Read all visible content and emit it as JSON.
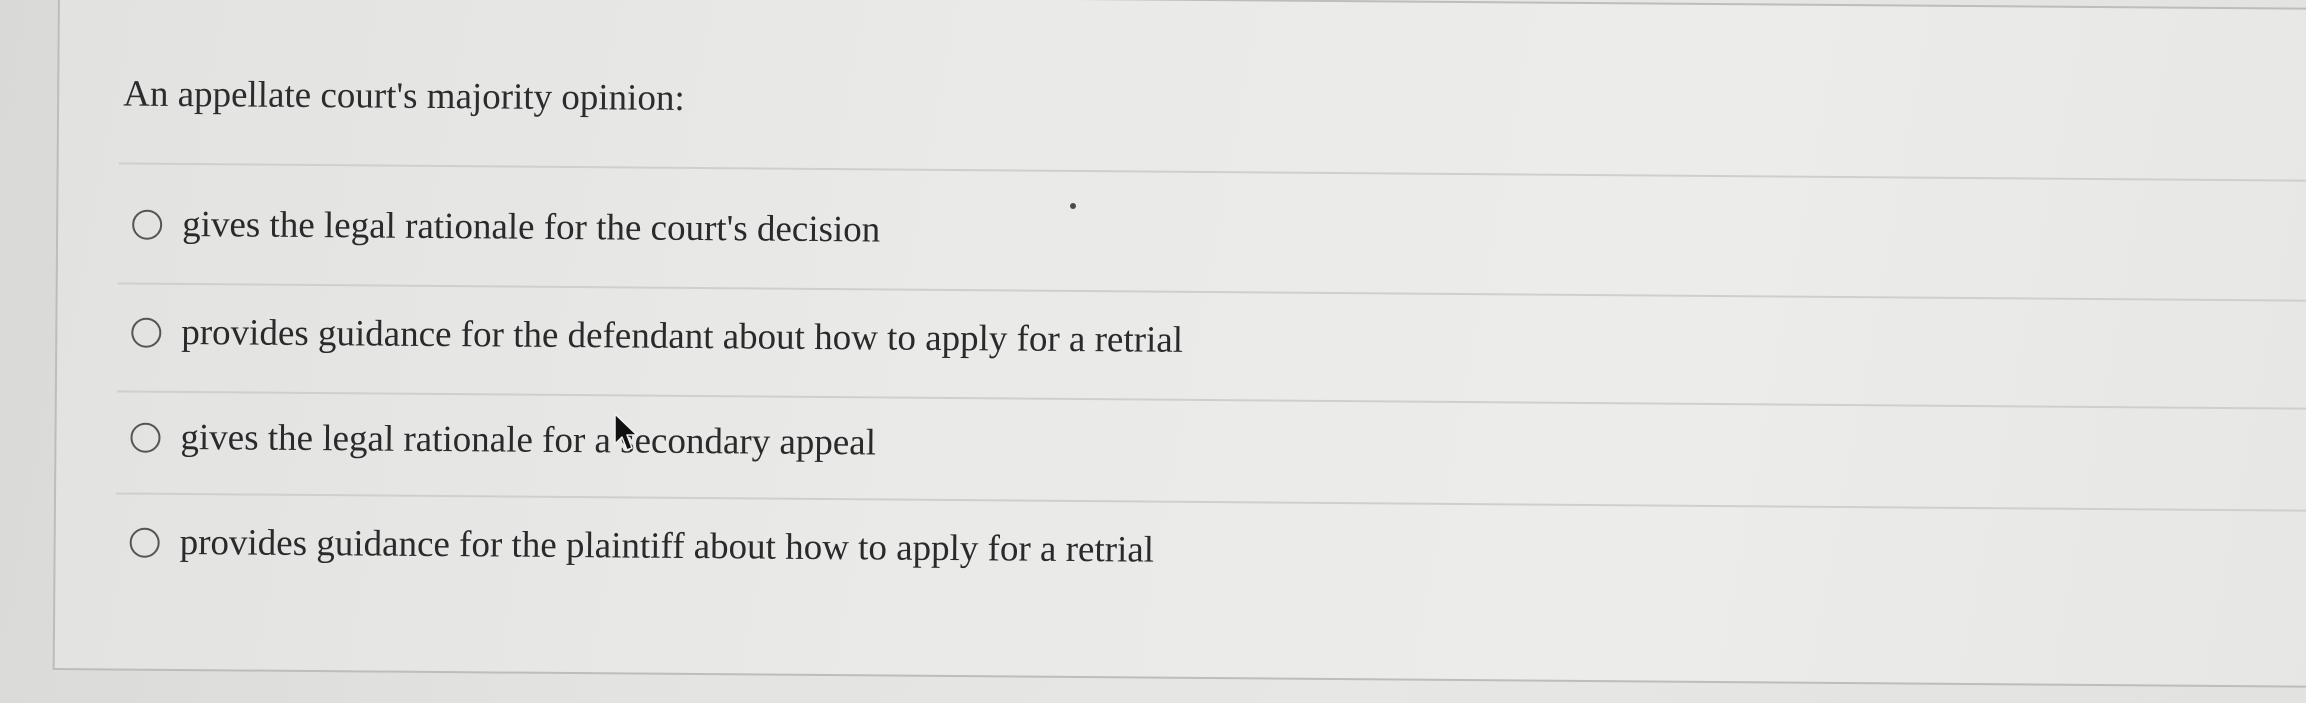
{
  "question": {
    "prompt": "An appellate court's majority opinion:"
  },
  "options": [
    {
      "label": "gives the legal rationale for the court's decision",
      "selected": false
    },
    {
      "label": "provides guidance for the defendant about how to apply for a retrial",
      "selected": false
    },
    {
      "label": "gives the legal rationale for a secondary appeal",
      "selected": false
    },
    {
      "label": "provides guidance for the plaintiff about how to apply for a retrial",
      "selected": false
    }
  ],
  "icons": {
    "radio": "radio-empty-icon",
    "cursor": "mouse-pointer-icon"
  }
}
